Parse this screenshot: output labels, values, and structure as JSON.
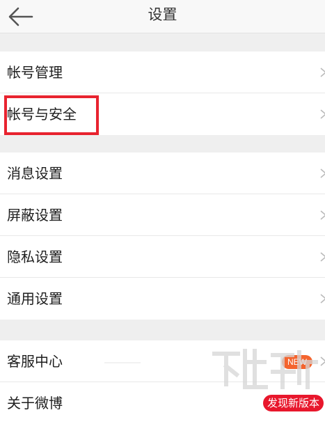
{
  "header": {
    "title": "设置"
  },
  "groups": [
    {
      "items": [
        {
          "label": "帐号管理"
        },
        {
          "label": "帐号与安全"
        }
      ]
    },
    {
      "items": [
        {
          "label": "消息设置"
        },
        {
          "label": "屏蔽设置"
        },
        {
          "label": "隐私设置"
        },
        {
          "label": "通用设置"
        }
      ]
    },
    {
      "items": [
        {
          "label": "客服中心",
          "badge": "NEW"
        },
        {
          "label": "关于微博",
          "badge": "发现新版本"
        }
      ]
    }
  ],
  "colors": {
    "highlight": "#e8232f",
    "badge_new": "#f4642e",
    "badge_version": "#e8172c",
    "background": "#efefef"
  },
  "icons": {
    "back": "arrow-left-icon",
    "chevron": "chevron-right-icon"
  }
}
